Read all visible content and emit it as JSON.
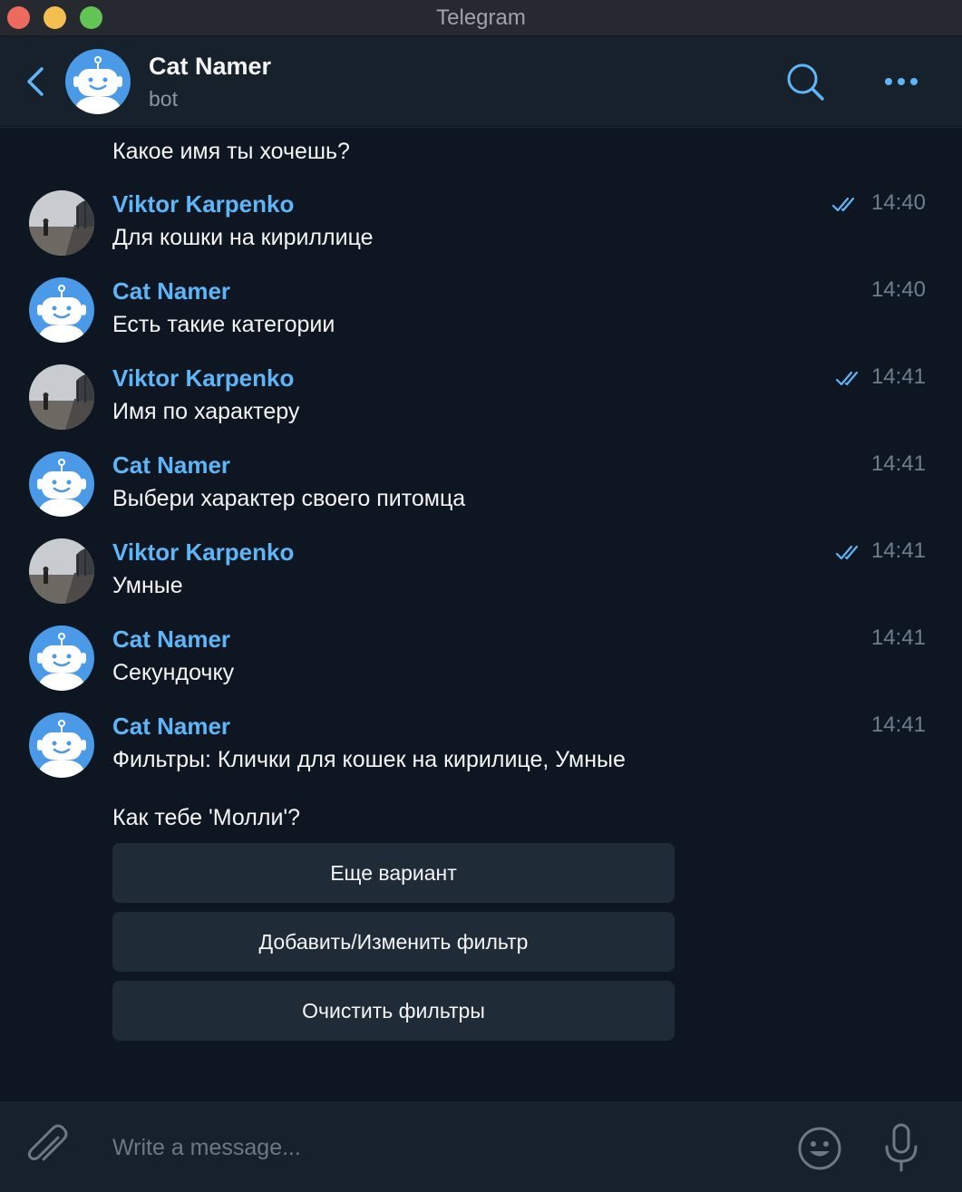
{
  "window": {
    "title": "Telegram"
  },
  "header": {
    "chat_title": "Cat Namer",
    "chat_status": "bot"
  },
  "messages": [
    {
      "id": "m0",
      "continuation": true,
      "text": "Какое имя ты хочешь?"
    },
    {
      "id": "m1",
      "sender": "Viktor Karpenko",
      "avatar": "user-photo",
      "text": "Для кошки на кириллице",
      "time": "14:40",
      "read": true
    },
    {
      "id": "m2",
      "sender": "Cat Namer",
      "avatar": "bot-robot",
      "text": "Есть такие категории",
      "time": "14:40",
      "read": false
    },
    {
      "id": "m3",
      "sender": "Viktor Karpenko",
      "avatar": "user-photo",
      "text": "Имя по характеру",
      "time": "14:41",
      "read": true
    },
    {
      "id": "m4",
      "sender": "Cat Namer",
      "avatar": "bot-robot",
      "text": "Выбери характер своего питомца",
      "time": "14:41",
      "read": false
    },
    {
      "id": "m5",
      "sender": "Viktor Karpenko",
      "avatar": "user-photo",
      "text": "Умные",
      "time": "14:41",
      "read": true
    },
    {
      "id": "m6",
      "sender": "Cat Namer",
      "avatar": "bot-robot",
      "text": "Секундочку",
      "time": "14:41",
      "read": false
    },
    {
      "id": "m7",
      "sender": "Cat Namer",
      "avatar": "bot-robot",
      "text": "Фильтры: Клички для кошек на кирилице, Умные",
      "text2": "Как тебе 'Молли'?",
      "time": "14:41",
      "read": false
    }
  ],
  "inline_buttons": [
    {
      "label": "Еще вариант"
    },
    {
      "label": "Добавить/Изменить фильтр"
    },
    {
      "label": "Очистить фильтры"
    }
  ],
  "composer": {
    "placeholder": "Write a message..."
  },
  "colors": {
    "accent": "#5eb5f7",
    "background": "#0e1621",
    "header": "#17212b",
    "button": "#202b38",
    "bot_avatar": "#4a9ae8"
  },
  "icons": {
    "back": "chevron-left-icon",
    "search": "search-icon",
    "more": "more-dots-icon",
    "attach": "paperclip-icon",
    "emoji": "smiley-icon",
    "mic": "microphone-icon",
    "read_receipt": "double-check-icon"
  }
}
